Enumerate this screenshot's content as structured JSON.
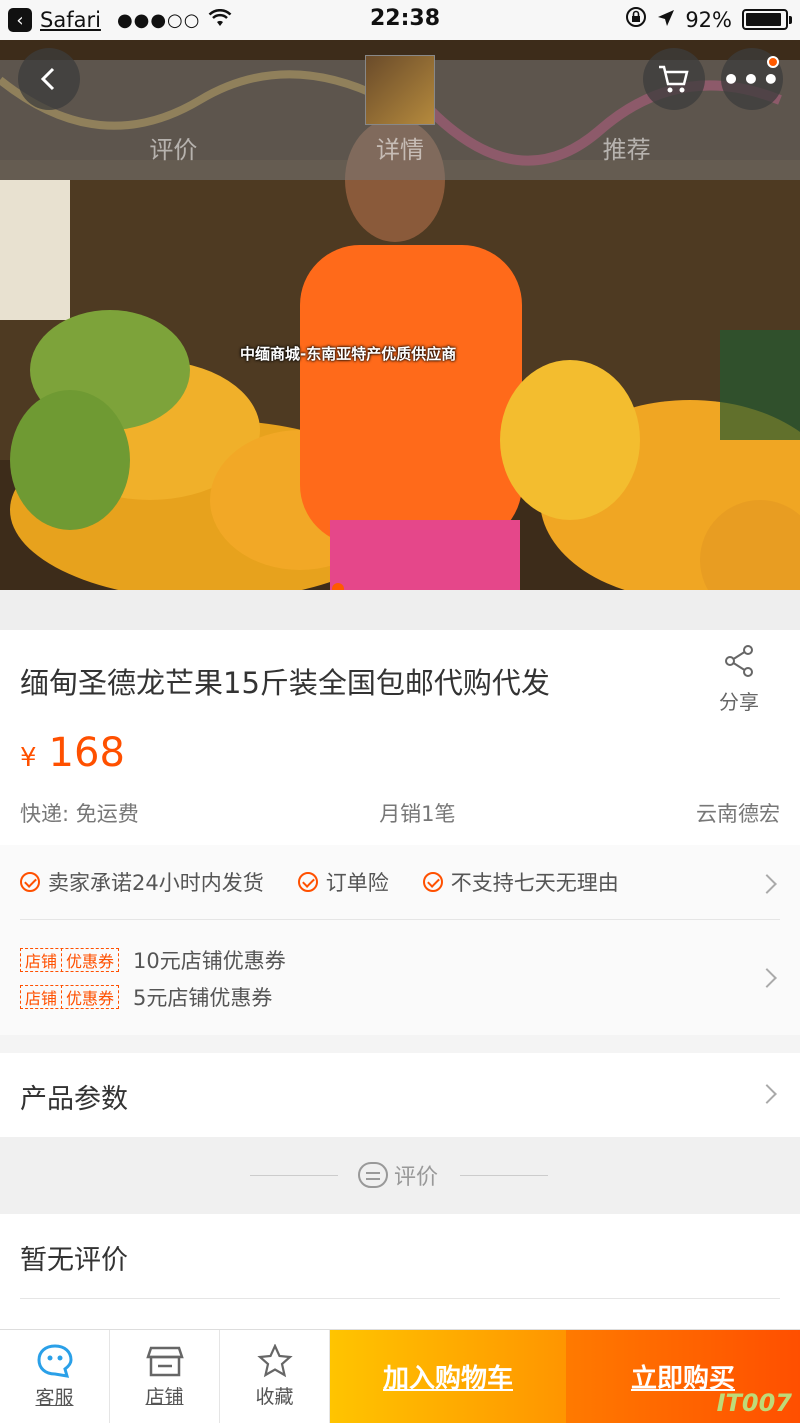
{
  "status_bar": {
    "back_app": "Safari",
    "signal": "●●●○○",
    "time": "22:38",
    "battery_percent": "92%",
    "battery_level": 0.92
  },
  "hero": {
    "tabs": [
      "评价",
      "详情",
      "推荐"
    ],
    "watermark": "中缅商城-东南亚特产优质供应商",
    "carousel_count": 1
  },
  "product": {
    "title": "缅甸圣德龙芒果15斤装全国包邮代购代发",
    "share_label": "分享",
    "currency": "¥",
    "price": "168",
    "shipping": "快递: 免运费",
    "monthly_sales": "月销1笔",
    "location": "云南德宏"
  },
  "promises": [
    "卖家承诺24小时内发货",
    "订单险",
    "不支持七天无理由"
  ],
  "coupons": {
    "tag_left": "店铺",
    "tag_right": "优惠券",
    "items": [
      "10元店铺优惠券",
      "5元店铺优惠券"
    ]
  },
  "params_label": "产品参数",
  "reviews": {
    "header": "评价",
    "empty": "暂无评价"
  },
  "bottom_bar": {
    "service": "客服",
    "shop": "店铺",
    "favorite": "收藏",
    "add_to_cart": "加入购物车",
    "buy_now": "立即购买",
    "brand": "IT007"
  },
  "colors": {
    "accent": "#ff5000",
    "cart_button": "#ffb000",
    "buy_button": "#ff5a00"
  }
}
